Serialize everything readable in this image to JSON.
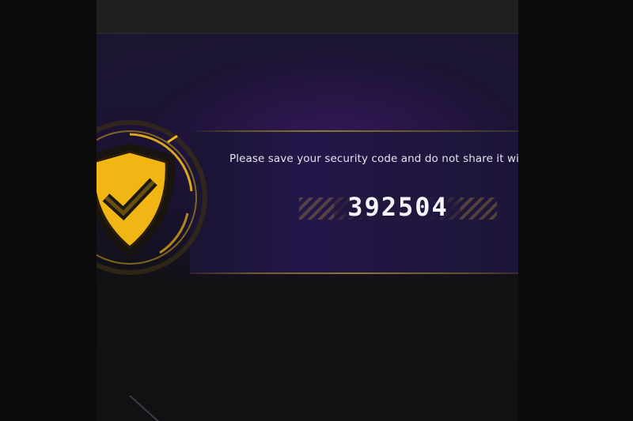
{
  "dialog": {
    "message": "Please save your security code and do not share it wi",
    "security_code": "392504"
  },
  "icons": {
    "emblem": "shield-check-icon"
  },
  "colors": {
    "accent_gold": "#f0b81a",
    "panel_purple": "#23174a",
    "text_light": "#e4e2ec"
  }
}
